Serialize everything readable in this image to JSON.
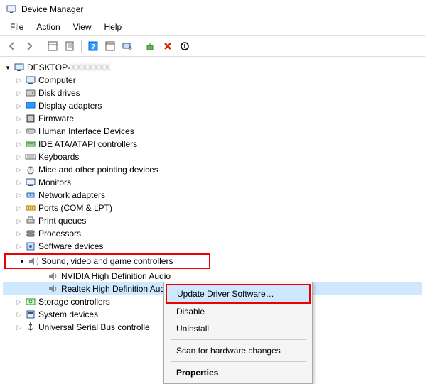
{
  "title": "Device Manager",
  "menus": [
    "File",
    "Action",
    "View",
    "Help"
  ],
  "root": "DESKTOP-",
  "rootBlur": "XXXXXXX",
  "categories": [
    {
      "label": "Computer",
      "icon": "computer"
    },
    {
      "label": "Disk drives",
      "icon": "disk"
    },
    {
      "label": "Display adapters",
      "icon": "display"
    },
    {
      "label": "Firmware",
      "icon": "firmware"
    },
    {
      "label": "Human Interface Devices",
      "icon": "hid"
    },
    {
      "label": "IDE ATA/ATAPI controllers",
      "icon": "ide"
    },
    {
      "label": "Keyboards",
      "icon": "keyboard"
    },
    {
      "label": "Mice and other pointing devices",
      "icon": "mouse"
    },
    {
      "label": "Monitors",
      "icon": "monitor"
    },
    {
      "label": "Network adapters",
      "icon": "network"
    },
    {
      "label": "Ports (COM & LPT)",
      "icon": "port"
    },
    {
      "label": "Print queues",
      "icon": "printer"
    },
    {
      "label": "Processors",
      "icon": "cpu"
    },
    {
      "label": "Software devices",
      "icon": "software"
    }
  ],
  "soundCategory": {
    "label": "Sound, video and game controllers",
    "icon": "speaker"
  },
  "soundChildren": [
    {
      "label": "NVIDIA High Definition Audio",
      "icon": "speaker",
      "selected": false
    },
    {
      "label": "Realtek High Definition Audio",
      "icon": "speaker",
      "selected": true
    }
  ],
  "afterCategories": [
    {
      "label": "Storage controllers",
      "icon": "storage"
    },
    {
      "label": "System devices",
      "icon": "system"
    },
    {
      "label": "Universal Serial Bus controlle",
      "icon": "usb"
    }
  ],
  "context": {
    "update": "Update Driver Software…",
    "disable": "Disable",
    "uninstall": "Uninstall",
    "scan": "Scan for hardware changes",
    "properties": "Properties"
  }
}
